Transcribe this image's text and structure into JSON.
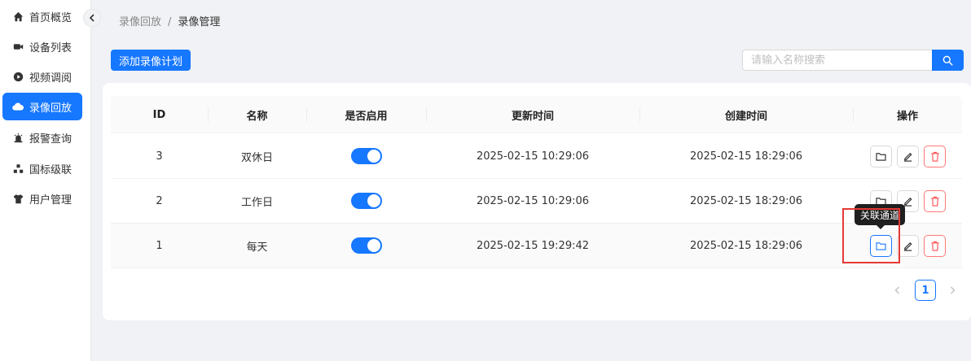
{
  "sidebar": {
    "items": [
      {
        "label": "首页概览",
        "icon": "home-icon"
      },
      {
        "label": "设备列表",
        "icon": "camera-icon"
      },
      {
        "label": "视频调阅",
        "icon": "play-circle-icon"
      },
      {
        "label": "录像回放",
        "icon": "cloud-icon",
        "active": true
      },
      {
        "label": "报警查询",
        "icon": "alarm-icon"
      },
      {
        "label": "国标级联",
        "icon": "cluster-icon"
      },
      {
        "label": "用户管理",
        "icon": "shirt-icon"
      }
    ],
    "collapse_icon": "chevron-left-icon"
  },
  "breadcrumb": {
    "parent": "录像回放",
    "separator": "/",
    "current": "录像管理"
  },
  "toolbar": {
    "add_label": "添加录像计划"
  },
  "search": {
    "placeholder": "请输入名称搜索",
    "value": "",
    "icon": "search-icon"
  },
  "table": {
    "headers": [
      "ID",
      "名称",
      "是否启用",
      "更新时间",
      "创建时间",
      "操作"
    ],
    "rows": [
      {
        "id": "3",
        "name": "双休日",
        "enabled": true,
        "updated": "2025-02-15 10:29:06",
        "created": "2025-02-15 18:29:06"
      },
      {
        "id": "2",
        "name": "工作日",
        "enabled": true,
        "updated": "2025-02-15 10:29:06",
        "created": "2025-02-15 18:29:06"
      },
      {
        "id": "1",
        "name": "每天",
        "enabled": true,
        "updated": "2025-02-15 19:29:42",
        "created": "2025-02-15 18:29:06"
      }
    ],
    "actions": [
      "folder-icon",
      "edit-icon",
      "delete-icon"
    ]
  },
  "tooltip": {
    "text": "关联通道"
  },
  "pagination": {
    "current": "1"
  },
  "colors": {
    "primary": "#1677ff",
    "danger": "#ff4d4f",
    "highlight": "#e53935"
  }
}
